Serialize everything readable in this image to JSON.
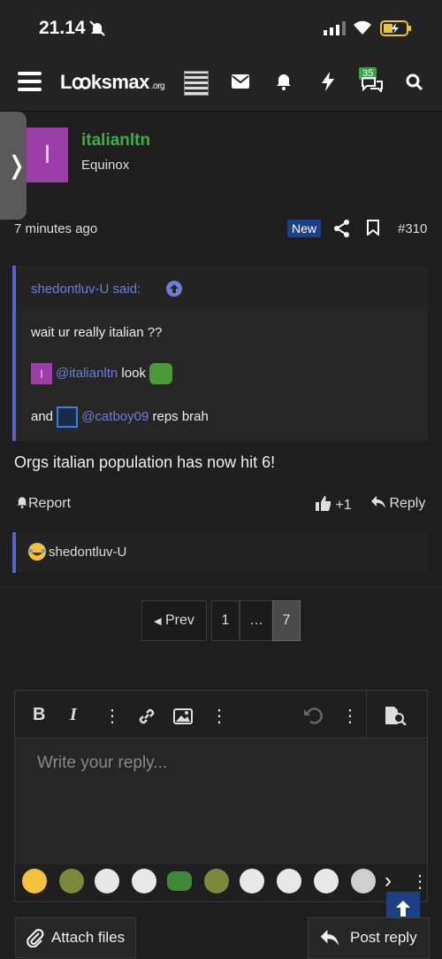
{
  "status_bar": {
    "time": "21.14"
  },
  "nav": {
    "logo_main": "Lꝏksmax",
    "logo_suffix": ".org",
    "alerts_count": "35"
  },
  "post": {
    "username": "italianltn",
    "user_title": "Equinox",
    "avatar_letter": "I",
    "time": "7 minutes ago",
    "new_label": "New",
    "number": "#310",
    "quote": {
      "author": "shedontluv-U said:",
      "line1": "wait ur really italian ??",
      "mention1": "@italianltn",
      "line2_suffix": " look",
      "line3_prefix": "and ",
      "mention2": "@catboy09",
      "line3_suffix": " reps brah",
      "mention1_avatar_letter": "I"
    },
    "body": "Orgs italian population has now hit 6!",
    "actions": {
      "report": "Report",
      "like": "+1",
      "reply": "Reply"
    },
    "reactions_user": "shedontluv-U"
  },
  "pagination": {
    "prev": "Prev",
    "first": "1",
    "ellipsis": "…",
    "current": "7"
  },
  "editor": {
    "placeholder": "Write your reply..."
  },
  "footer": {
    "attach": "Attach files",
    "post_reply": "Post reply"
  },
  "colors": {
    "accent_blue": "#5566c8",
    "username_green": "#3fae44",
    "badge_blue": "#1b3f8a",
    "avatar_purple": "#9b3ea7"
  }
}
